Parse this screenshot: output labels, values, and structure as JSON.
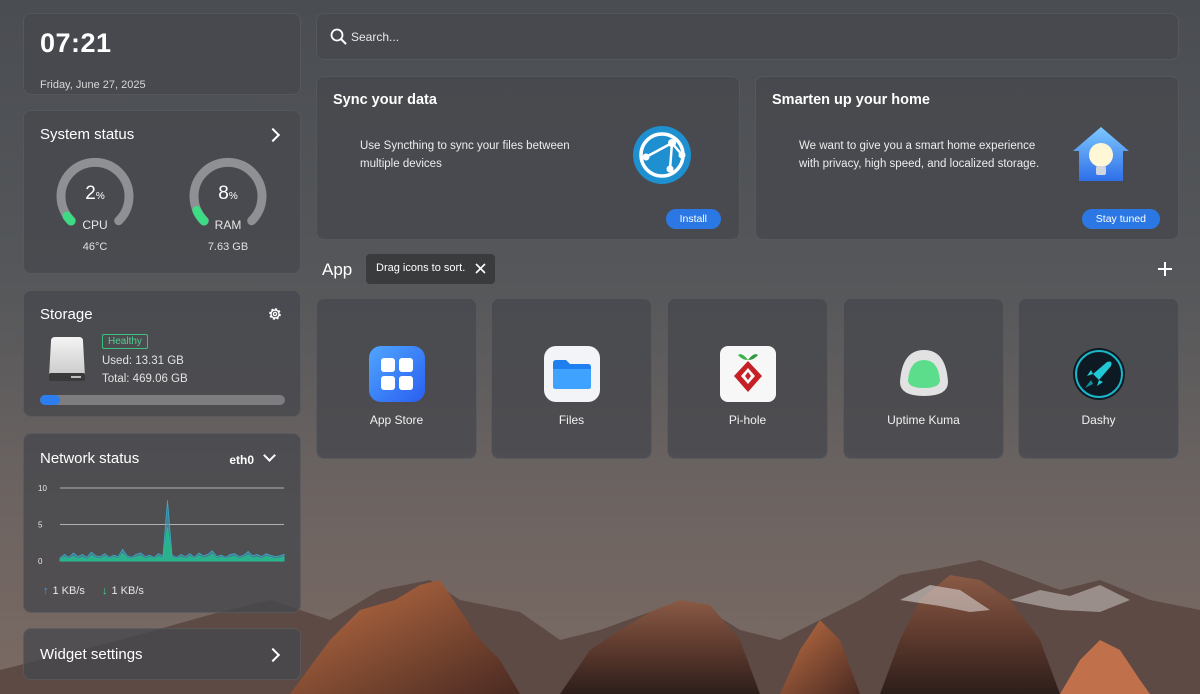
{
  "clock": {
    "time": "07:21",
    "date": "Friday, June 27, 2025"
  },
  "system_status": {
    "title": "System status",
    "cpu": {
      "value": "2",
      "unit": "%",
      "label": "CPU",
      "sub": "46°C",
      "percent": 2
    },
    "ram": {
      "value": "8",
      "unit": "%",
      "label": "RAM",
      "sub": "7.63 GB",
      "percent": 8
    }
  },
  "storage": {
    "title": "Storage",
    "health": "Healthy",
    "used": "Used: 13.31 GB",
    "total": "Total: 469.06 GB",
    "used_fraction": 0.028
  },
  "network": {
    "title": "Network status",
    "interface": "eth0",
    "upload": "1 KB/s",
    "download": "1 KB/s",
    "chart_data": {
      "type": "area",
      "y_ticks": [
        "10",
        "5",
        "0"
      ],
      "ylim": [
        0,
        10
      ],
      "series": [
        {
          "values": [
            0.4,
            0.9,
            0.5,
            1.1,
            0.6,
            0.9,
            0.5,
            1.2,
            0.7,
            0.6,
            1.0,
            0.5,
            0.8,
            0.6,
            1.6,
            0.7,
            0.5,
            0.9,
            1.1,
            0.6,
            0.8,
            0.5,
            1.0,
            0.7,
            8.3,
            0.8,
            0.5,
            0.9,
            0.6,
            1.0,
            0.5,
            1.1,
            0.7,
            0.9,
            1.4,
            0.6,
            0.8,
            0.5,
            0.9,
            1.0,
            0.6,
            0.8,
            1.3,
            0.7,
            0.9,
            0.6,
            1.0,
            0.8,
            0.6,
            0.7,
            0.9
          ]
        },
        {
          "values": [
            0.2,
            0.5,
            0.3,
            0.6,
            0.3,
            0.5,
            0.2,
            0.7,
            0.4,
            0.3,
            0.6,
            0.3,
            0.5,
            0.3,
            1.0,
            0.4,
            0.3,
            0.5,
            0.7,
            0.3,
            0.5,
            0.3,
            0.6,
            0.4,
            4.6,
            0.5,
            0.3,
            0.5,
            0.3,
            0.6,
            0.3,
            0.7,
            0.4,
            0.5,
            0.9,
            0.3,
            0.5,
            0.3,
            0.5,
            0.6,
            0.3,
            0.5,
            0.8,
            0.4,
            0.5,
            0.3,
            0.6,
            0.5,
            0.3,
            0.4,
            0.5
          ]
        }
      ],
      "colors": [
        "#3aa8c8",
        "#22c08a"
      ]
    }
  },
  "widget_settings": {
    "title": "Widget settings"
  },
  "search": {
    "placeholder": "Search..."
  },
  "promos": {
    "sync": {
      "title": "Sync your data",
      "description": "Use Syncthing to sync your files between multiple devices",
      "button": "Install"
    },
    "home": {
      "title": "Smarten up your home",
      "description": "We want to give you a smart home experience with privacy, high speed, and localized storage.",
      "button": "Stay tuned"
    }
  },
  "apps_section": {
    "title": "App",
    "tooltip": "Drag icons to sort."
  },
  "apps": [
    {
      "name": "App Store",
      "icon": "app-store-icon"
    },
    {
      "name": "Files",
      "icon": "folder-icon"
    },
    {
      "name": "Pi-hole",
      "icon": "pihole-icon"
    },
    {
      "name": "Uptime Kuma",
      "icon": "uptime-kuma-icon"
    },
    {
      "name": "Dashy",
      "icon": "dashy-icon"
    }
  ],
  "colors": {
    "accent": "#2b78e4",
    "gauge_green": "#3ddc84",
    "healthy": "#4fd08f"
  }
}
